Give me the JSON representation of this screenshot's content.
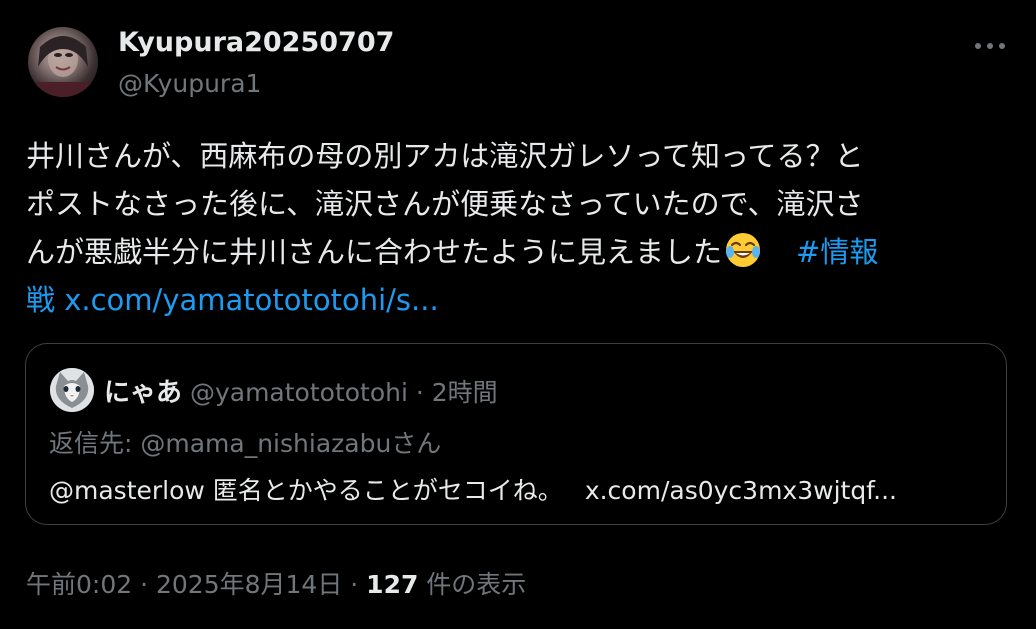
{
  "author": {
    "display_name": "Kyupura20250707",
    "handle": "@Kyupura1"
  },
  "tweet": {
    "lines": [
      "井川さんが、西麻布の母の別アカは滝沢ガレソって知ってる？と",
      "ポストなさった後に、滝沢さんが便乗なさっていたので、滝沢さ",
      "んが悪戯半分に井川さんに合わせたように見えました"
    ],
    "emoji_name": "face-with-tears-of-joy",
    "hashtag_part1": "#情報",
    "hashtag_part2": "戦",
    "link_text": "x.com/yamatotototohi/s..."
  },
  "quote": {
    "name": "にゃあ",
    "handle": "@yamatotototohi",
    "separator": " · ",
    "time": "2時間",
    "reply_label": "返信先: @mama_nishiazabuさん",
    "mention": "@masterlow",
    "body": " 匿名とかやることがセコイね。",
    "link_text": "x.com/as0yc3mx3wjtqf..."
  },
  "footer": {
    "time": "午前0:02",
    "separator": " · ",
    "date": "2025年8月14日",
    "views_count": "127",
    "views_label": " 件の表示"
  },
  "colors": {
    "background": "#000000",
    "text": "#e7e9ea",
    "secondary": "#71767b",
    "link": "#1d9bf0",
    "border": "#3c4043"
  },
  "icons": {
    "more": "more-horizontal-icon"
  }
}
